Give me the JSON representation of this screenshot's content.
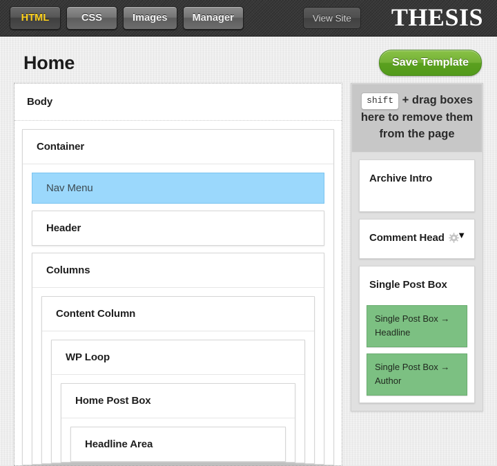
{
  "topbar": {
    "nav_buttons": [
      {
        "label": "HTML",
        "active": true
      },
      {
        "label": "CSS",
        "active": false
      },
      {
        "label": "Images",
        "active": false
      },
      {
        "label": "Manager",
        "active": false
      }
    ],
    "view_site_label": "View Site",
    "logo": "THESIS",
    "background_color": "#393939",
    "active_text_color": "#ffd21d"
  },
  "header": {
    "page_title": "Home",
    "save_button_label": "Save Template",
    "save_button_color": "#74b135"
  },
  "canvas": {
    "body": {
      "label": "Body",
      "container": {
        "label": "Container",
        "nav_menu": {
          "label": "Nav Menu",
          "selected": true,
          "highlight_color": "#9bd8fc"
        },
        "header_box": {
          "label": "Header"
        },
        "columns": {
          "label": "Columns",
          "content_column": {
            "label": "Content Column",
            "wp_loop": {
              "label": "WP Loop",
              "home_post_box": {
                "label": "Home Post Box",
                "headline_area": {
                  "label": "Headline Area"
                }
              }
            }
          }
        }
      }
    }
  },
  "sidebar": {
    "dropzone": {
      "key_label": "shift",
      "text": "+ drag boxes here to remove them from the page",
      "background_color": "#c7c7c7"
    },
    "items": [
      {
        "label": "Archive Intro",
        "tall": true,
        "caret": false,
        "gear": false,
        "children": []
      },
      {
        "label": "Comment Head",
        "tall": false,
        "caret": true,
        "caret_glyph": "▼",
        "gear": true,
        "children": []
      },
      {
        "label": "Single Post Box",
        "tall": false,
        "caret": false,
        "gear": false,
        "children": [
          {
            "label": "Single Post Box → Headline",
            "color": "#7cc082"
          },
          {
            "label": "Single Post Box → Author",
            "color": "#7cc082"
          }
        ]
      }
    ]
  }
}
